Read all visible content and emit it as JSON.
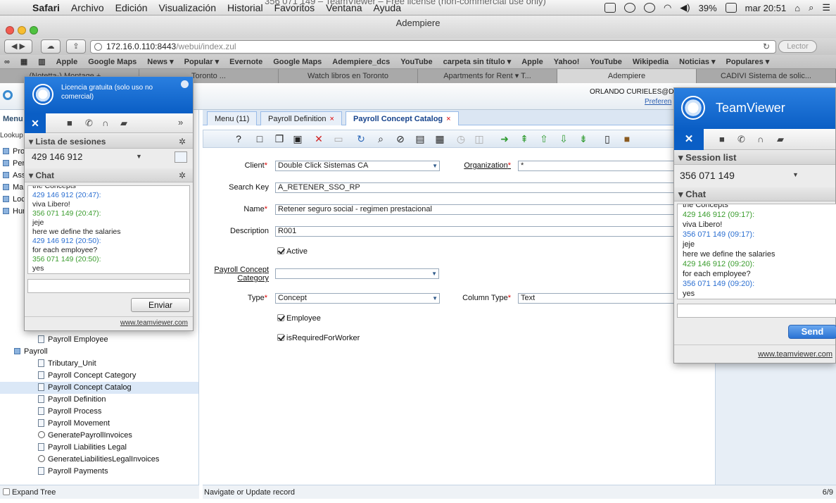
{
  "mac_menubar": {
    "app": "Safari",
    "items": [
      "Archivo",
      "Edición",
      "Visualización",
      "Historial",
      "Favoritos",
      "Ventana",
      "Ayuda"
    ],
    "overlay_title": "356 071 149 – TeamViewer – Free license (non-commercial use only)",
    "battery": "39%",
    "clock": "mar 20:51"
  },
  "safari": {
    "window_title": "Adempiere",
    "url_host": "172.16.0.110:8443",
    "url_path": "/webui/index.zul",
    "reader": "Lector",
    "bookmarks": [
      "Apple",
      "Google Maps",
      "News ▾",
      "Popular ▾",
      "Evernote",
      "Google Maps",
      "Adempiere_dcs",
      "YouTube",
      "carpeta sin título ▾",
      "Apple",
      "Yahoo!",
      "YouTube",
      "Wikipedia",
      "Noticias ▾",
      "Populares ▾"
    ],
    "tabs": [
      "(Notetta-) Montage + ...",
      "Toronto ...",
      "Watch libros en Toronto",
      "Apartments for Rent ▾ T...",
      "Adempiere",
      "CADIVI Sistema de solic..."
    ]
  },
  "app_header": {
    "user": "ORLANDO CURIELES@Do",
    "preferences": "Preferen"
  },
  "left_panel": {
    "menu_label": "Menu",
    "lookup_label": "Lookup",
    "top_items": [
      "Pro",
      "Per",
      "Ass",
      "Mar",
      "Loc",
      "Hum"
    ],
    "tree": [
      {
        "label": "Payroll Employee",
        "type": "window",
        "indent": 2
      },
      {
        "label": "Payroll",
        "type": "folder",
        "indent": 1
      },
      {
        "label": "Tributary_Unit",
        "type": "window",
        "indent": 2
      },
      {
        "label": "Payroll Concept Category",
        "type": "window",
        "indent": 2
      },
      {
        "label": "Payroll Concept Catalog",
        "type": "window",
        "indent": 2,
        "selected": true
      },
      {
        "label": "Payroll Definition",
        "type": "window",
        "indent": 2
      },
      {
        "label": "Payroll Process",
        "type": "window",
        "indent": 2
      },
      {
        "label": "Payroll Movement",
        "type": "window",
        "indent": 2
      },
      {
        "label": "GeneratePayrollInvoices",
        "type": "process",
        "indent": 2
      },
      {
        "label": "Payroll Liabilities Legal",
        "type": "window",
        "indent": 2
      },
      {
        "label": "GenerateLiabilitiesLegalInvoices",
        "type": "process",
        "indent": 2
      },
      {
        "label": "Payroll Payments",
        "type": "window",
        "indent": 2
      }
    ],
    "expand_tree": "Expand Tree"
  },
  "doc_tabs": [
    {
      "label": "Menu (11)",
      "closable": false
    },
    {
      "label": "Payroll Definition",
      "closable": true
    },
    {
      "label": "Payroll Concept Catalog",
      "closable": true,
      "active": true
    }
  ],
  "form": {
    "client": {
      "label": "Client",
      "value": "Double Click Sistemas CA"
    },
    "organization": {
      "label": "Organization",
      "value": "*"
    },
    "search_key": {
      "label": "Search Key",
      "value": "A_RETENER_SSO_RP"
    },
    "name": {
      "label": "Name",
      "value": "Retener seguro social - regimen prestacional"
    },
    "description": {
      "label": "Description",
      "value": "R001"
    },
    "active": {
      "label": "Active",
      "checked": true
    },
    "category": {
      "label_line1": "Payroll Concept",
      "label_line2": "Category",
      "value": ""
    },
    "type": {
      "label": "Type",
      "value": "Concept"
    },
    "column_type": {
      "label": "Column Type",
      "value": "Text"
    },
    "employee": {
      "label": "Employee",
      "checked": true
    },
    "required": {
      "label": "isRequiredForWorker",
      "checked": true
    }
  },
  "status_bar": {
    "message": "Navigate or Update record",
    "page": "6/9"
  },
  "tv_left": {
    "license": "Licencia gratuita (solo uso no comercial)",
    "session_header": "Lista de sesiones",
    "session_id": "429 146 912",
    "chat_header": "Chat",
    "chat": [
      {
        "text": "the Concepts",
        "color": "msg"
      },
      {
        "text": "429 146 912 (20:47):",
        "color": "b"
      },
      {
        "text": "viva Libero!",
        "color": "msg"
      },
      {
        "text": "356 071 149 (20:47):",
        "color": "g"
      },
      {
        "text": "jeje",
        "color": "msg"
      },
      {
        "text": "here we define the salaries",
        "color": "msg"
      },
      {
        "text": "429 146 912 (20:50):",
        "color": "b"
      },
      {
        "text": "for each employee?",
        "color": "msg"
      },
      {
        "text": "356 071 149 (20:50):",
        "color": "g"
      },
      {
        "text": "yes",
        "color": "msg"
      }
    ],
    "send": "Enviar",
    "link": "www.teamviewer.com"
  },
  "tv_right": {
    "brand": "TeamViewer",
    "session_header": "Session list",
    "session_id": "356 071 149",
    "chat_header": "Chat",
    "chat": [
      {
        "text": "the Concepts",
        "color": "msg"
      },
      {
        "text": "429 146 912 (09:17):",
        "color": "g"
      },
      {
        "text": "viva Libero!",
        "color": "msg"
      },
      {
        "text": "356 071 149 (09:17):",
        "color": "b"
      },
      {
        "text": "jeje",
        "color": "msg"
      },
      {
        "text": "here we define the salaries",
        "color": "msg"
      },
      {
        "text": "429 146 912 (09:20):",
        "color": "g"
      },
      {
        "text": "for each employee?",
        "color": "msg"
      },
      {
        "text": "356 071 149 (09:20):",
        "color": "b"
      },
      {
        "text": "yes",
        "color": "msg"
      }
    ],
    "send": "Send",
    "link": "www.teamviewer.com"
  },
  "colors": {
    "tv_blue": "#0a5ec5",
    "chat_green": "#3a9c2d",
    "chat_blue": "#2a6ed1",
    "selected_row": "#dbe8f7",
    "required_mark": "#dd0000"
  }
}
